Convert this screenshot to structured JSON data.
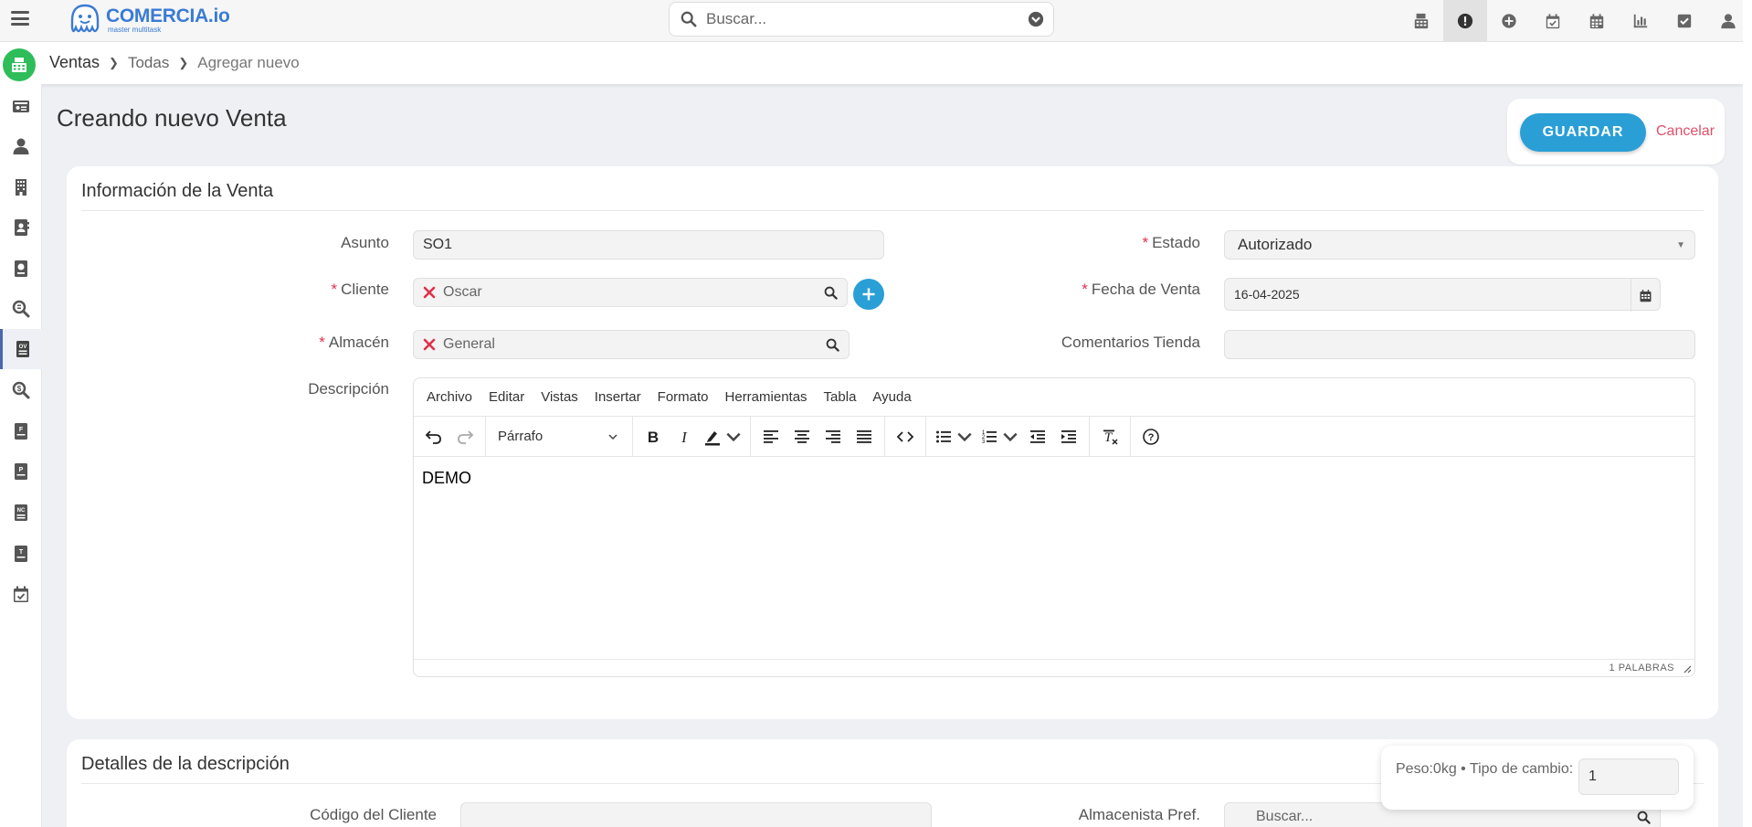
{
  "app": {
    "logo_name": "COMERCIA.io",
    "logo_sub": "master multitask"
  },
  "search": {
    "placeholder": "Buscar..."
  },
  "top_icons": [
    "calculator-icon",
    "alert-icon",
    "plus-circle-icon",
    "calendar-check-icon",
    "calendar-icon",
    "bar-chart-icon",
    "checkbox-icon",
    "user-icon"
  ],
  "breadcrumb": {
    "module": "Ventas",
    "level1": "Todas",
    "current": "Agregar nuevo"
  },
  "page": {
    "title": "Creando nuevo Venta"
  },
  "actions": {
    "save_label": "GUARDAR",
    "cancel_label": "Cancelar"
  },
  "section1": {
    "title": "Información de la Venta",
    "asunto": {
      "label": "Asunto",
      "value": "SO1"
    },
    "estado": {
      "label": "Estado",
      "value": "Autorizado"
    },
    "cliente": {
      "label": "Cliente",
      "value": "Oscar"
    },
    "fecha": {
      "label": "Fecha de Venta",
      "value": "16-04-2025"
    },
    "almacen": {
      "label": "Almacén",
      "value": "General"
    },
    "comentarios": {
      "label": "Comentarios Tienda",
      "value": ""
    },
    "descripcion": {
      "label": "Descripción"
    }
  },
  "editor": {
    "menus": [
      "Archivo",
      "Editar",
      "Vistas",
      "Insertar",
      "Formato",
      "Herramientas",
      "Tabla",
      "Ayuda"
    ],
    "block_format": "Párrafo",
    "content": "DEMO",
    "word_count": "1 PALABRAS"
  },
  "section2": {
    "title": "Detalles de la descripción",
    "codigo_cliente": {
      "label": "Código del Cliente",
      "value": ""
    },
    "almacenista": {
      "label": "Almacenista Pref.",
      "placeholder": "Buscar..."
    }
  },
  "weight_box": {
    "text": "Peso:0kg • Tipo de cambio:",
    "exchange_rate": "1"
  },
  "colors": {
    "accent": "#2a9fd6",
    "required": "#e0304a",
    "cancel": "#e0506a",
    "module_badge": "#2ebd59",
    "brand": "#3a7bd5"
  }
}
